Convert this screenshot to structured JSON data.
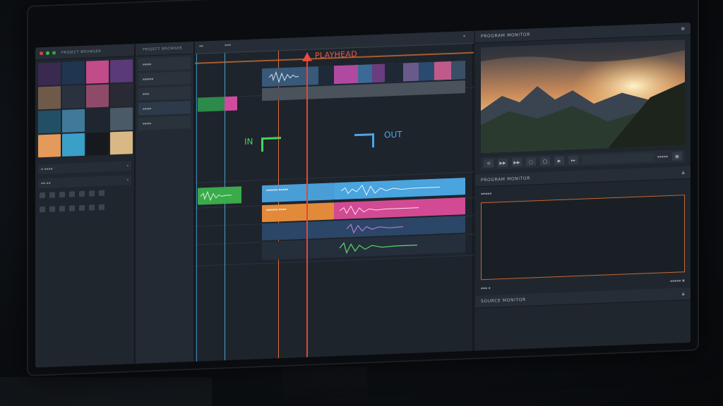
{
  "left_panel": {
    "title": "PROJECT BROWSER",
    "thumbnails": [
      {
        "color": "#3a2a4f"
      },
      {
        "color": "#1f3550"
      },
      {
        "color": "#c24b8a"
      },
      {
        "color": "#5a3a78"
      },
      {
        "color": "#6f5a4a"
      },
      {
        "color": "#2a3240"
      },
      {
        "color": "#8f4a6a"
      },
      {
        "color": "#2a2a34"
      },
      {
        "color": "#234f66"
      },
      {
        "color": "#3f7a9a"
      },
      {
        "color": "#1f2630"
      },
      {
        "color": "#4a5a66"
      },
      {
        "color": "#e39a5a"
      },
      {
        "color": "#3aa0c8"
      },
      {
        "color": "#16191e"
      },
      {
        "color": "#d8b884"
      }
    ]
  },
  "bin_panel": {
    "title": "PROJECT BROWSER"
  },
  "timeline": {
    "playhead_label": "PLAYHEAD",
    "in_label": "IN",
    "out_label": "OUT"
  },
  "right_panel": {
    "program_title": "PROGRAM MONITOR",
    "second_title": "PROGRAM MONITOR",
    "source_title": "SOURCE MONITOR"
  },
  "colors": {
    "playhead": "#e2473a",
    "in_marker": "#45d35d",
    "out_marker": "#4aa6e8",
    "accent_orange": "#c96a2e"
  }
}
